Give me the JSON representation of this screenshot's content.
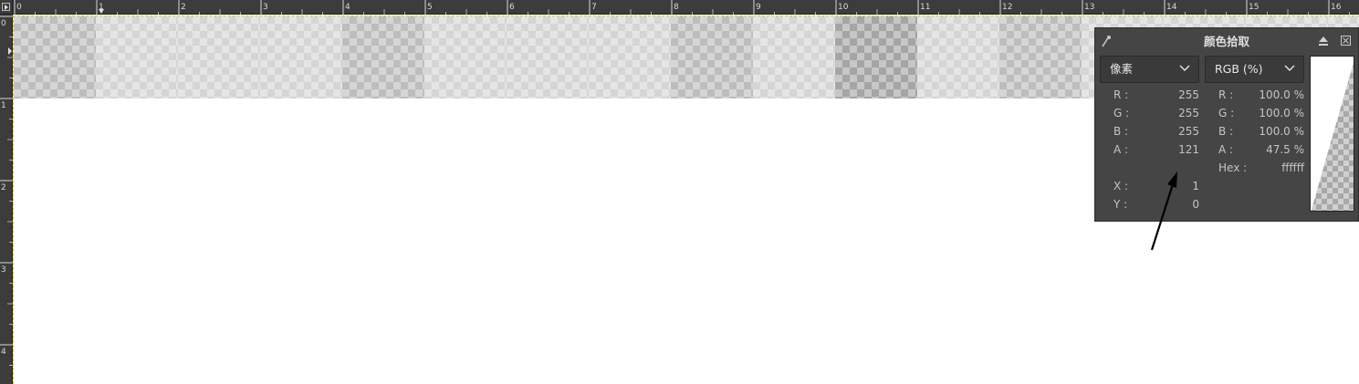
{
  "rulers": {
    "horizontal_labels": [
      "0",
      "1",
      "2",
      "3",
      "4",
      "5",
      "6",
      "7",
      "8",
      "9",
      "10",
      "11",
      "12",
      "13",
      "14",
      "15",
      "16"
    ],
    "vertical_labels": [
      "0",
      "1",
      "2",
      "3",
      "4"
    ]
  },
  "canvas": {
    "pixel_row_alpha": [
      0.55,
      0.35,
      0.35,
      0.35,
      0.55,
      0.35,
      0.35,
      0.35,
      0.55,
      0.35,
      0.75,
      0.35,
      0.55,
      0.35,
      0.35,
      0.35,
      0.35
    ]
  },
  "picker": {
    "title": "颜色拾取",
    "mode1": "像素",
    "mode2": "RGB (%)",
    "left": [
      {
        "label": "R :",
        "value": "255"
      },
      {
        "label": "G :",
        "value": "255"
      },
      {
        "label": "B :",
        "value": "255"
      },
      {
        "label": "A :",
        "value": "121"
      }
    ],
    "right": [
      {
        "label": "R :",
        "value": "100.0 %"
      },
      {
        "label": "G :",
        "value": "100.0 %"
      },
      {
        "label": "B :",
        "value": "100.0 %"
      },
      {
        "label": "A :",
        "value": "47.5 %"
      },
      {
        "label": "Hex :",
        "value": "ffffff"
      }
    ],
    "coords": [
      {
        "label": "X :",
        "value": "1"
      },
      {
        "label": "Y :",
        "value": "0"
      }
    ]
  },
  "colors": {
    "panel_bg": "#454545",
    "selection_border": "#d4c400",
    "ruler_bg": "#3c3c3c"
  }
}
